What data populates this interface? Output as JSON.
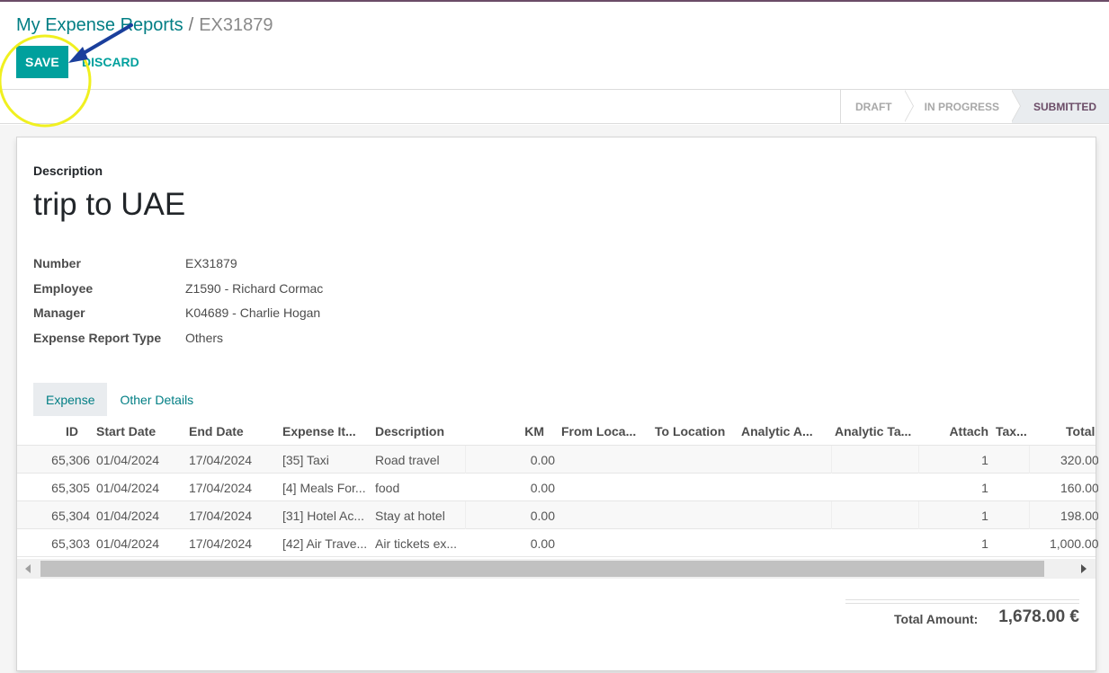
{
  "breadcrumb": {
    "parent": "My Expense Reports",
    "separator": "/",
    "current": "EX31879"
  },
  "toolbar": {
    "save_label": "SAVE",
    "discard_label": "DISCARD"
  },
  "statusbar": {
    "steps": [
      {
        "label": "DRAFT",
        "active": false
      },
      {
        "label": "IN PROGRESS",
        "active": false
      },
      {
        "label": "SUBMITTED",
        "active": true
      }
    ]
  },
  "form": {
    "description_label": "Description",
    "description_value": "trip to UAE",
    "fields": [
      {
        "label": "Number",
        "value": "EX31879"
      },
      {
        "label": "Employee",
        "value": "Z1590 - Richard Cormac"
      },
      {
        "label": "Manager",
        "value": "K04689 - Charlie Hogan"
      },
      {
        "label": "Expense Report Type",
        "value": "Others"
      }
    ]
  },
  "tabs": [
    {
      "label": "Expense",
      "active": true
    },
    {
      "label": "Other Details",
      "active": false
    }
  ],
  "table": {
    "columns": [
      "ID",
      "Start Date",
      "End Date",
      "Expense It...",
      "Description",
      "KM",
      "From Loca...",
      "To Location",
      "Analytic A...",
      "Analytic Ta...",
      "Attach",
      "Tax...",
      "Total"
    ],
    "rows": [
      {
        "id": "65,306",
        "start": "01/04/2024",
        "end": "17/04/2024",
        "item": "[35] Taxi",
        "description": "Road travel",
        "km": "0.00",
        "from": "",
        "to": "",
        "analytic_account": "",
        "analytic_tags": "",
        "attach": "1",
        "tax": "",
        "total": "320.00"
      },
      {
        "id": "65,305",
        "start": "01/04/2024",
        "end": "17/04/2024",
        "item": "[4] Meals For...",
        "description": "food",
        "km": "0.00",
        "from": "",
        "to": "",
        "analytic_account": "",
        "analytic_tags": "",
        "attach": "1",
        "tax": "",
        "total": "160.00"
      },
      {
        "id": "65,304",
        "start": "01/04/2024",
        "end": "17/04/2024",
        "item": "[31] Hotel Ac...",
        "description": "Stay at hotel",
        "km": "0.00",
        "from": "",
        "to": "",
        "analytic_account": "",
        "analytic_tags": "",
        "attach": "1",
        "tax": "",
        "total": "198.00"
      },
      {
        "id": "65,303",
        "start": "01/04/2024",
        "end": "17/04/2024",
        "item": "[42] Air Trave...",
        "description": "Air tickets ex...",
        "km": "0.00",
        "from": "",
        "to": "",
        "analytic_account": "",
        "analytic_tags": "",
        "attach": "1",
        "tax": "",
        "total": "1,000.00"
      }
    ]
  },
  "totals": {
    "label": "Total Amount:",
    "value": "1,678.00 €"
  },
  "colors": {
    "primary": "#00a09d",
    "link": "#017e84",
    "status_active": "#6b4c67",
    "annotation_circle": "#f0f020",
    "annotation_arrow": "#1a3f9c"
  }
}
